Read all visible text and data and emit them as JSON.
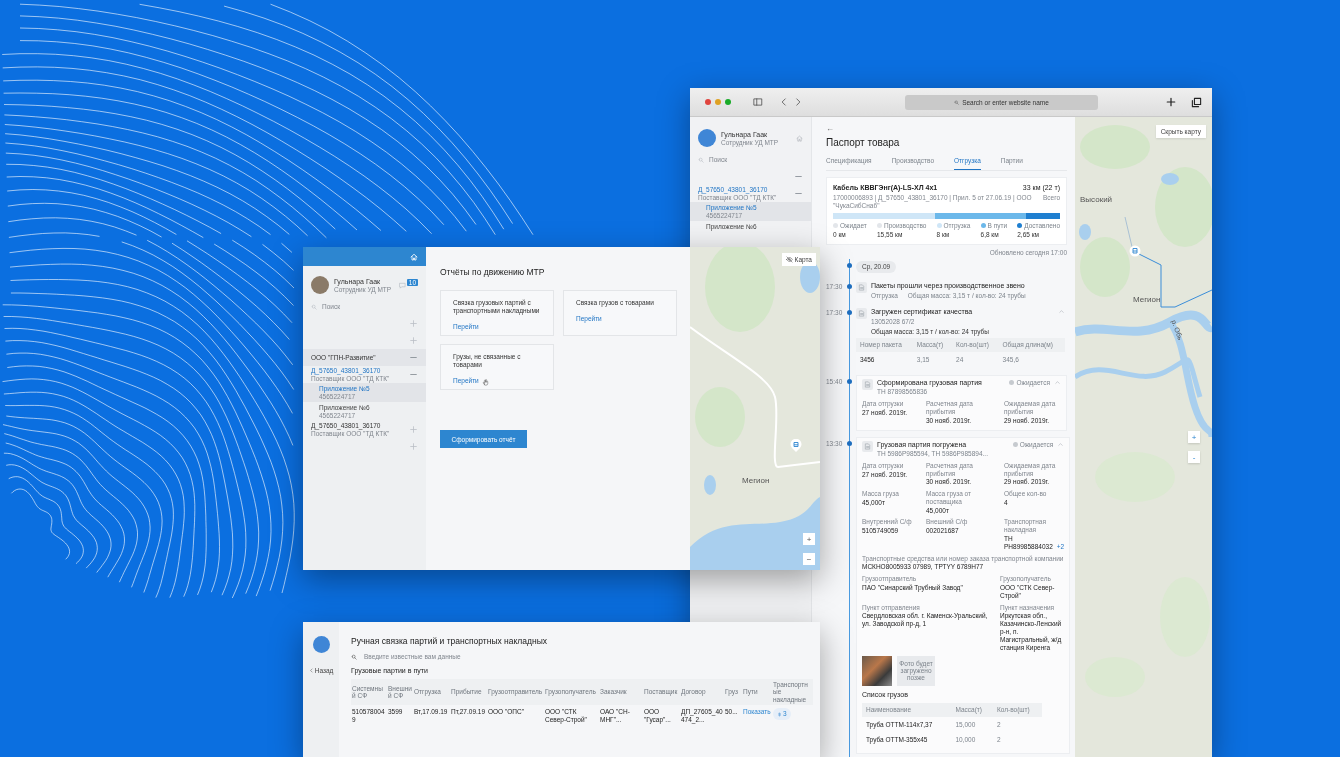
{
  "browser": {
    "address_placeholder": "Search or enter website name",
    "sidebar": {
      "user": {
        "name": "Гульнара Гаак",
        "role": "Сотрудник УД МТР"
      },
      "search_placeholder": "Поиск",
      "items": [
        {
          "kind": "blank",
          "expanded": true
        },
        {
          "kind": "contract",
          "title": "Д_57650_43801_36170",
          "subtitle": "Поставщик ООО \"ТД КТК\"",
          "expanded": true,
          "children": [
            {
              "title": "Приложение №5",
              "subtitle": "4565224717",
              "selected": true
            },
            {
              "title": "Приложение №6",
              "selected": false
            }
          ]
        }
      ]
    },
    "page": {
      "back": "←",
      "title": "Паспорт товара",
      "tabs": [
        {
          "label": "Спецификация",
          "selected": false
        },
        {
          "label": "Производство",
          "selected": false
        },
        {
          "label": "Отгрузка",
          "selected": true
        },
        {
          "label": "Партии",
          "selected": false
        }
      ],
      "product": {
        "name": "Кабель КВВГЭнг(А)-LS-ХЛ 4х1",
        "code": "17000006893 | Д_57650_43801_36170 | Прил. 5 от 27.06.19 | ООО \"ЧукаСибСнаб\"",
        "total": "33 км (22 т)",
        "total_label": "Всего",
        "segments": [
          {
            "level": 0.55,
            "color": "#6cb8ea"
          },
          {
            "level": 0.15,
            "color": "#1f7fd0"
          }
        ],
        "stats": [
          {
            "label": "Ожидает",
            "value": "0 км",
            "color": "#e3e6ea"
          },
          {
            "label": "Производство",
            "value": "15,55 км",
            "color": "#e3e6ea"
          },
          {
            "label": "Отгрузка",
            "value": "8 км",
            "color": "#cfe6f7"
          },
          {
            "label": "В пути",
            "value": "6,8 км",
            "color": "#6cb8ea"
          },
          {
            "label": "Доставлено",
            "value": "2,65 км",
            "color": "#1f7fd0"
          }
        ]
      },
      "updated": "Обновлено сегодня 17:00",
      "date_chip": "Ср, 20.09",
      "events": [
        {
          "kind": "note",
          "time": "17:30",
          "title": "Пакеты прошли через производственное звено",
          "subtitle": "Отгрузка",
          "summary": "Общая масса: 3,15 т / кол-во: 24 трубы"
        },
        {
          "kind": "certificate",
          "time": "17:30",
          "title": "Загружен сертификат качества",
          "subtitle": "13052028 67/2",
          "expanded": true,
          "summary": "Общая масса: 3,15 т / кол-во: 24 трубы",
          "table": {
            "columns": [
              "Номер пакета",
              "Масса(т)",
              "Кол-во(шт)",
              "Общая длина(м)"
            ],
            "rows": [
              [
                "3456",
                "3,15",
                "24",
                "345,6"
              ]
            ]
          }
        },
        {
          "kind": "batch",
          "time": "15:40",
          "title": "Сформирована грузовая партия",
          "subtitle": "ТН 87898565836",
          "status": "Ожидается",
          "expanded": true,
          "field_rows": [
            [
              {
                "label": "Дата отгрузки",
                "value": "27 нояб. 2019г."
              },
              {
                "label": "Расчетная дата прибытия",
                "value": "30 нояб. 2019г."
              },
              {
                "label": "Ожидаемая дата прибытия",
                "value": "29 нояб. 2019г."
              }
            ]
          ]
        },
        {
          "kind": "batch",
          "time": "13:30",
          "title": "Грузовая партия погружена",
          "subtitle": "ТН 5986Р985594, ТН 5986Р985894...",
          "status": "Ожидается",
          "expanded": true,
          "field_rows": [
            [
              {
                "label": "Дата отгрузки",
                "value": "27 нояб. 2019г."
              },
              {
                "label": "Расчетная дата прибытия",
                "value": "30 нояб. 2019г."
              },
              {
                "label": "Ожидаемая дата прибытия",
                "value": "29 нояб. 2019г."
              }
            ],
            [
              {
                "label": "Масса груза",
                "value": "45,000т"
              },
              {
                "label": "Масса груза от поставщика",
                "value": "45,000т"
              },
              {
                "label": "Общее кол-во",
                "value": "4"
              }
            ],
            [
              {
                "label": "Внутренний С/ф",
                "value": "5105749059"
              },
              {
                "label": "Внешний С/ф",
                "value": "002021687"
              },
              {
                "label": "Транспортная накладная",
                "value": "ТН РН89985884032",
                "extra": "+2"
              }
            ],
            [
              {
                "label": "Транспортные средства или номер заказа транспортной компании",
                "value": "МСКНО8005933 07989, ТРТYY 6789Н77"
              }
            ],
            [
              {
                "label": "Грузоотправитель",
                "value": "ПАО \"Синарский Трубный Завод\""
              },
              {
                "label": "Грузополучатель",
                "value": "ООО \"СТК Север-Строй\""
              }
            ],
            [
              {
                "label": "Пункт отправления",
                "value": "Свердловская обл. г. Каменск-Уральский, ул. Заводской пр-д, 1"
              },
              {
                "label": "Пункт назначения",
                "value": "Иркутская обл., Казачинско-Ленский р-н, п. Магистральный, ж/д станция Киренга"
              }
            ]
          ],
          "photos": [
            {
              "kind": "photo"
            },
            {
              "kind": "pending",
              "text": "Фото будет загружено позже"
            }
          ],
          "cargo": {
            "title": "Список грузов",
            "columns": [
              "Наименование",
              "Масса(т)",
              "Кол-во(шт)"
            ],
            "rows": [
              [
                "Труба ОТТМ-114х7,37",
                "15,000",
                "2"
              ],
              [
                "Труба ОТТМ-355х45",
                "10,000",
                "2"
              ]
            ]
          }
        }
      ]
    },
    "map": {
      "hide_button": "Скрыть карту",
      "labels": [
        {
          "kind": "town",
          "text": "Высокий"
        },
        {
          "kind": "town",
          "text": "Мегион"
        },
        {
          "kind": "river",
          "text": "р. Обь"
        }
      ],
      "zoom_in": "+",
      "zoom_out": "-"
    }
  },
  "reports": {
    "sidebar": {
      "user": {
        "name": "Гульнара Гаак",
        "role": "Сотрудник УД МТР"
      },
      "badge": "10",
      "search_placeholder": "Поиск",
      "items": [
        {
          "kind": "blank",
          "expanded": false
        },
        {
          "kind": "blank",
          "expanded": false
        },
        {
          "kind": "company",
          "title": "ООО \"ГПН-Развитие\"",
          "expanded": true
        },
        {
          "kind": "contract",
          "title": "Д_57650_43801_36170",
          "subtitle": "Поставщик ООО \"ТД КТК\"",
          "expanded": true,
          "children": [
            {
              "title": "Приложение №5",
              "subtitle": "4565224717",
              "selected": true
            },
            {
              "title": "Приложение №6",
              "subtitle": "4565224717",
              "selected": false
            }
          ]
        },
        {
          "kind": "contract",
          "title": "Д_57650_43801_36170",
          "subtitle": "Поставщик ООО \"ТД КТК\"",
          "expanded": false
        },
        {
          "kind": "blank",
          "expanded": false
        }
      ]
    },
    "title": "Отчёты по движению МТР",
    "cards": [
      {
        "text": "Связка грузовых партий с транспортными накладными",
        "link": "Перейти",
        "hovered": false
      },
      {
        "text": "Связка грузов с товарами",
        "link": "Перейти",
        "hovered": false
      },
      {
        "text": "Грузы, не связанные с товарами",
        "link": "Перейти",
        "hovered": true
      }
    ],
    "button": "Сформировать отчёт",
    "map": {
      "toggle": "Карта",
      "label": "Мегион",
      "zoom_in": "+",
      "zoom_out": "−"
    }
  },
  "linking": {
    "back": "Назад",
    "title": "Ручная связка партий и транспортных накладных",
    "search_placeholder": "Введите известные вам данные",
    "section": "Грузовые партии в пути",
    "table": {
      "columns": [
        "Системный СФ",
        "Внешний СФ",
        "Отгрузка",
        "Прибытие",
        "Грузоотправитель",
        "Грузополучатель",
        "Заказчик",
        "Поставщик",
        "Договор",
        "Груз",
        "Пути",
        "Транспортные накладные"
      ],
      "rows": [
        {
          "cells": [
            "5105780049",
            "3599",
            "Вт,17.09.19",
            "Пт,27.09.19",
            "ООО \"ОПС\"",
            "ООО \"СТК Север-Строй\"",
            "ОАО \"СН-МНГ\"...",
            "ООО \"Гусар\"...",
            "ДП_27605_40474_2...",
            "50..."
          ],
          "link": "Показать",
          "attachments": "3"
        }
      ]
    }
  }
}
